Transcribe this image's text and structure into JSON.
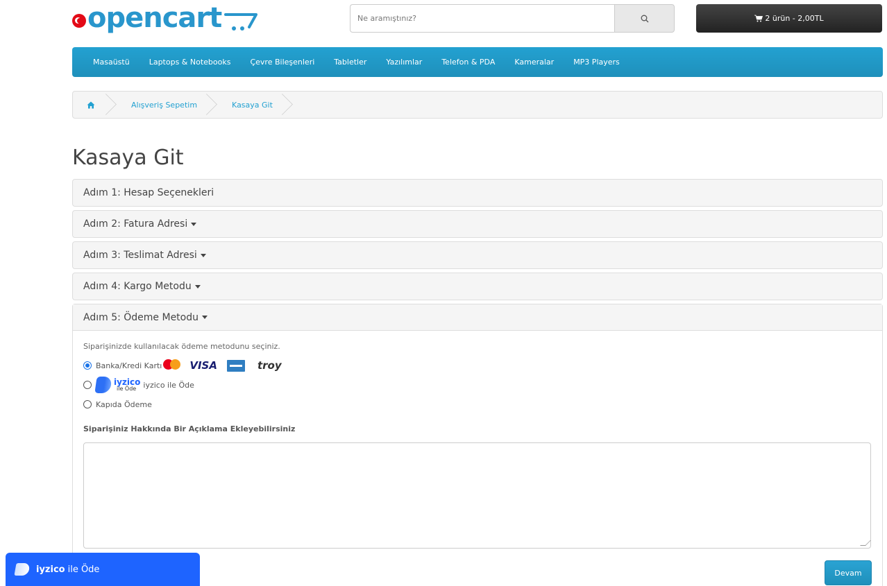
{
  "header": {
    "logo_text": "opencart",
    "search_placeholder": "Ne aramıştınız?",
    "cart_label": "2 ürün - 2,00TL"
  },
  "nav": {
    "items": [
      "Masaüstü",
      "Laptops & Notebooks",
      "Çevre Bileşenleri",
      "Tabletler",
      "Yazılımlar",
      "Telefon & PDA",
      "Kameralar",
      "MP3 Players"
    ]
  },
  "breadcrumb": {
    "items": [
      "Alışveriş Sepetim",
      "Kasaya Git"
    ]
  },
  "page_title": "Kasaya Git",
  "steps": [
    {
      "label": "Adım 1: Hesap Seçenekleri"
    },
    {
      "label": "Adım 2: Fatura Adresi"
    },
    {
      "label": "Adım 3: Teslimat Adresi"
    },
    {
      "label": "Adım 4: Kargo Metodu"
    },
    {
      "label": "Adım 5: Ödeme Metodu"
    }
  ],
  "payment": {
    "intro": "Siparişinizde kullanılacak ödeme metodunu seçiniz.",
    "methods": [
      {
        "label": "Banka/Kredi Kartı",
        "selected": true
      },
      {
        "label": "iyzico ile Öde",
        "selected": false
      },
      {
        "label": "Kapıda Ödeme",
        "selected": false
      }
    ],
    "card_brands": {
      "visa": "VISA",
      "troy": "troy"
    },
    "iyzico_logo": {
      "brand": "iyzico",
      "sub": "ile Öde"
    },
    "comment_label": "Siparişiniz Hakkında Bir Açıklama Ekleyebilirsiniz",
    "comment_value": "",
    "continue_label": "Devam"
  },
  "iyzico_float": {
    "brand": "iyzico",
    "suffix": "ile Öde"
  },
  "colors": {
    "brand_blue": "#23a1d1",
    "iyzico_blue": "#1e64ff"
  }
}
